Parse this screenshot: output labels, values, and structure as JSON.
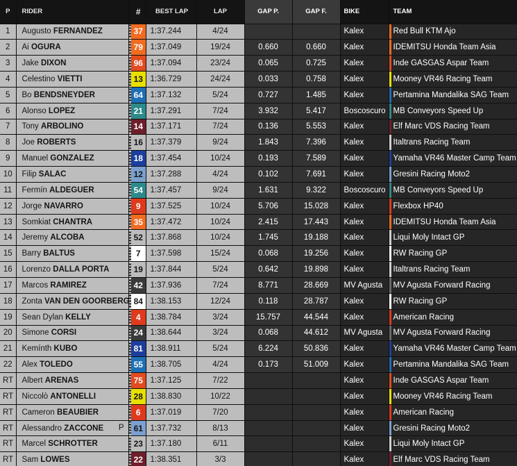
{
  "headers": {
    "p": "P",
    "rider": "RIDER",
    "num": "#",
    "best_lap": "BEST LAP",
    "lap": "LAP",
    "gap_p": "GAP P.",
    "gap_f": "GAP F.",
    "bike": "BIKE",
    "team": "TEAM"
  },
  "rows": [
    {
      "pos": "1",
      "first": "Augusto",
      "last": "FERNANDEZ",
      "pit": "",
      "num": "37",
      "num_bg": "#f26b21",
      "num_fg": "#ffffff",
      "best": "1:37.244",
      "lap": "4/24",
      "gap_p": "",
      "gap_f": "",
      "bike": "Kalex",
      "team": "Red Bull KTM Ajo",
      "team_color": "#f26b21"
    },
    {
      "pos": "2",
      "first": "Ai",
      "last": "OGURA",
      "pit": "",
      "num": "79",
      "num_bg": "#f26b21",
      "num_fg": "#ffffff",
      "best": "1:37.049",
      "lap": "19/24",
      "gap_p": "0.660",
      "gap_f": "0.660",
      "bike": "Kalex",
      "team": "IDEMITSU Honda Team Asia",
      "team_color": "#f26b21"
    },
    {
      "pos": "3",
      "first": "Jake",
      "last": "DIXON",
      "pit": "",
      "num": "96",
      "num_bg": "#e34b1f",
      "num_fg": "#ffffff",
      "best": "1:37.094",
      "lap": "23/24",
      "gap_p": "0.065",
      "gap_f": "0.725",
      "bike": "Kalex",
      "team": "Inde GASGAS Aspar Team",
      "team_color": "#e34b1f"
    },
    {
      "pos": "4",
      "first": "Celestino",
      "last": "VIETTI",
      "pit": "",
      "num": "13",
      "num_bg": "#e8e000",
      "num_fg": "#141414",
      "best": "1:36.729",
      "lap": "24/24",
      "gap_p": "0.033",
      "gap_f": "0.758",
      "bike": "Kalex",
      "team": "Mooney VR46 Racing Team",
      "team_color": "#e8e000"
    },
    {
      "pos": "5",
      "first": "Bo",
      "last": "BENDSNEYDER",
      "pit": "",
      "num": "64",
      "num_bg": "#1f6fb5",
      "num_fg": "#ffffff",
      "best": "1:37.132",
      "lap": "5/24",
      "gap_p": "0.727",
      "gap_f": "1.485",
      "bike": "Kalex",
      "team": "Pertamina Mandalika SAG Team",
      "team_color": "#1f6fb5"
    },
    {
      "pos": "6",
      "first": "Alonso",
      "last": "LOPEZ",
      "pit": "",
      "num": "21",
      "num_bg": "#2d8a8a",
      "num_fg": "#ffffff",
      "best": "1:37.291",
      "lap": "7/24",
      "gap_p": "3.932",
      "gap_f": "5.417",
      "bike": "Boscoscuro",
      "team": "MB Conveyors Speed Up",
      "team_color": "#2d8a8a"
    },
    {
      "pos": "7",
      "first": "Tony",
      "last": "ARBOLINO",
      "pit": "",
      "num": "14",
      "num_bg": "#6e1f2b",
      "num_fg": "#ffffff",
      "best": "1:37.171",
      "lap": "7/24",
      "gap_p": "0.136",
      "gap_f": "5.553",
      "bike": "Kalex",
      "team": "Elf Marc VDS Racing Team",
      "team_color": "#6e1f2b"
    },
    {
      "pos": "8",
      "first": "Joe",
      "last": "ROBERTS",
      "pit": "",
      "num": "16",
      "num_bg": "#bdbdbd",
      "num_fg": "#141414",
      "best": "1:37.379",
      "lap": "9/24",
      "gap_p": "1.843",
      "gap_f": "7.396",
      "bike": "Kalex",
      "team": "Italtrans Racing Team",
      "team_color": "#d0d0d0"
    },
    {
      "pos": "9",
      "first": "Manuel",
      "last": "GONZALEZ",
      "pit": "",
      "num": "18",
      "num_bg": "#1c3f9e",
      "num_fg": "#ffffff",
      "best": "1:37.454",
      "lap": "10/24",
      "gap_p": "0.193",
      "gap_f": "7.589",
      "bike": "Kalex",
      "team": "Yamaha VR46 Master Camp Team",
      "team_color": "#1c3f9e"
    },
    {
      "pos": "10",
      "first": "Filip",
      "last": "SALAC",
      "pit": "",
      "num": "12",
      "num_bg": "#7aa0d0",
      "num_fg": "#141414",
      "best": "1:37.288",
      "lap": "4/24",
      "gap_p": "0.102",
      "gap_f": "7.691",
      "bike": "Kalex",
      "team": "Gresini Racing Moto2",
      "team_color": "#7aa0d0"
    },
    {
      "pos": "11",
      "first": "Fermín",
      "last": "ALDEGUER",
      "pit": "",
      "num": "54",
      "num_bg": "#2d8a8a",
      "num_fg": "#ffffff",
      "best": "1:37.457",
      "lap": "9/24",
      "gap_p": "1.631",
      "gap_f": "9.322",
      "bike": "Boscoscuro",
      "team": "MB Conveyors Speed Up",
      "team_color": "#2d8a8a"
    },
    {
      "pos": "12",
      "first": "Jorge",
      "last": "NAVARRO",
      "pit": "",
      "num": "9",
      "num_bg": "#e03a1e",
      "num_fg": "#ffffff",
      "best": "1:37.525",
      "lap": "10/24",
      "gap_p": "5.706",
      "gap_f": "15.028",
      "bike": "Kalex",
      "team": "Flexbox HP40",
      "team_color": "#e03a1e"
    },
    {
      "pos": "13",
      "first": "Somkiat",
      "last": "CHANTRA",
      "pit": "",
      "num": "35",
      "num_bg": "#f26b21",
      "num_fg": "#ffffff",
      "best": "1:37.472",
      "lap": "10/24",
      "gap_p": "2.415",
      "gap_f": "17.443",
      "bike": "Kalex",
      "team": "IDEMITSU Honda Team Asia",
      "team_color": "#f26b21"
    },
    {
      "pos": "14",
      "first": "Jeremy",
      "last": "ALCOBA",
      "pit": "",
      "num": "52",
      "num_bg": "#bdbdbd",
      "num_fg": "#141414",
      "best": "1:37.868",
      "lap": "10/24",
      "gap_p": "1.745",
      "gap_f": "19.188",
      "bike": "Kalex",
      "team": "Liqui Moly Intact GP",
      "team_color": "#d0d0d0"
    },
    {
      "pos": "15",
      "first": "Barry",
      "last": "BALTUS",
      "pit": "",
      "num": "7",
      "num_bg": "#ffffff",
      "num_fg": "#141414",
      "best": "1:37.598",
      "lap": "15/24",
      "gap_p": "0.068",
      "gap_f": "19.256",
      "bike": "Kalex",
      "team": "RW Racing GP",
      "team_color": "#ffffff"
    },
    {
      "pos": "16",
      "first": "Lorenzo",
      "last": "DALLA PORTA",
      "pit": "",
      "num": "19",
      "num_bg": "#bdbdbd",
      "num_fg": "#141414",
      "best": "1:37.844",
      "lap": "5/24",
      "gap_p": "0.642",
      "gap_f": "19.898",
      "bike": "Kalex",
      "team": "Italtrans Racing Team",
      "team_color": "#d0d0d0"
    },
    {
      "pos": "17",
      "first": "Marcos",
      "last": "RAMIREZ",
      "pit": "",
      "num": "42",
      "num_bg": "#3a3a3a",
      "num_fg": "#ffffff",
      "best": "1:37.936",
      "lap": "7/24",
      "gap_p": "8.771",
      "gap_f": "28.669",
      "bike": "MV Agusta",
      "team": "MV Agusta Forward Racing",
      "team_color": "#6b6b6b"
    },
    {
      "pos": "18",
      "first": "Zonta",
      "last": "VAN DEN GOORBERGH",
      "pit": "",
      "num": "84",
      "num_bg": "#ffffff",
      "num_fg": "#141414",
      "best": "1:38.153",
      "lap": "12/24",
      "gap_p": "0.118",
      "gap_f": "28.787",
      "bike": "Kalex",
      "team": "RW Racing GP",
      "team_color": "#ffffff"
    },
    {
      "pos": "19",
      "first": "Sean Dylan",
      "last": "KELLY",
      "pit": "",
      "num": "4",
      "num_bg": "#e03a1e",
      "num_fg": "#ffffff",
      "best": "1:38.784",
      "lap": "3/24",
      "gap_p": "15.757",
      "gap_f": "44.544",
      "bike": "Kalex",
      "team": "American Racing",
      "team_color": "#e03a1e"
    },
    {
      "pos": "20",
      "first": "Simone",
      "last": "CORSI",
      "pit": "",
      "num": "24",
      "num_bg": "#3a3a3a",
      "num_fg": "#ffffff",
      "best": "1:38.644",
      "lap": "3/24",
      "gap_p": "0.068",
      "gap_f": "44.612",
      "bike": "MV Agusta",
      "team": "MV Agusta Forward Racing",
      "team_color": "#6b6b6b"
    },
    {
      "pos": "21",
      "first": "Kemínth",
      "last": "KUBO",
      "pit": "",
      "num": "81",
      "num_bg": "#1c3f9e",
      "num_fg": "#ffffff",
      "best": "1:38.911",
      "lap": "5/24",
      "gap_p": "6.224",
      "gap_f": "50.836",
      "bike": "Kalex",
      "team": "Yamaha VR46 Master Camp Team",
      "team_color": "#1c3f9e"
    },
    {
      "pos": "22",
      "first": "Alex",
      "last": "TOLEDO",
      "pit": "",
      "num": "55",
      "num_bg": "#1f6fb5",
      "num_fg": "#ffffff",
      "best": "1:38.705",
      "lap": "4/24",
      "gap_p": "0.173",
      "gap_f": "51.009",
      "bike": "Kalex",
      "team": "Pertamina Mandalika SAG Team",
      "team_color": "#1f6fb5"
    },
    {
      "pos": "RT",
      "first": "Albert",
      "last": "ARENAS",
      "pit": "",
      "num": "75",
      "num_bg": "#e34b1f",
      "num_fg": "#ffffff",
      "best": "1:37.125",
      "lap": "7/22",
      "gap_p": "",
      "gap_f": "",
      "bike": "Kalex",
      "team": "Inde GASGAS Aspar Team",
      "team_color": "#e34b1f"
    },
    {
      "pos": "RT",
      "first": "Niccolò",
      "last": "ANTONELLI",
      "pit": "",
      "num": "28",
      "num_bg": "#e8e000",
      "num_fg": "#141414",
      "best": "1:38.830",
      "lap": "10/22",
      "gap_p": "",
      "gap_f": "",
      "bike": "Kalex",
      "team": "Mooney VR46 Racing Team",
      "team_color": "#e8e000"
    },
    {
      "pos": "RT",
      "first": "Cameron",
      "last": "BEAUBIER",
      "pit": "",
      "num": "6",
      "num_bg": "#e03a1e",
      "num_fg": "#ffffff",
      "best": "1:37.019",
      "lap": "7/20",
      "gap_p": "",
      "gap_f": "",
      "bike": "Kalex",
      "team": "American Racing",
      "team_color": "#e03a1e"
    },
    {
      "pos": "RT",
      "first": "Alessandro",
      "last": "ZACCONE",
      "pit": "P",
      "num": "61",
      "num_bg": "#7aa0d0",
      "num_fg": "#141414",
      "best": "1:37.732",
      "lap": "8/13",
      "gap_p": "",
      "gap_f": "",
      "bike": "Kalex",
      "team": "Gresini Racing Moto2",
      "team_color": "#7aa0d0"
    },
    {
      "pos": "RT",
      "first": "Marcel",
      "last": "SCHROTTER",
      "pit": "",
      "num": "23",
      "num_bg": "#bdbdbd",
      "num_fg": "#141414",
      "best": "1:37.180",
      "lap": "6/11",
      "gap_p": "",
      "gap_f": "",
      "bike": "Kalex",
      "team": "Liqui Moly Intact GP",
      "team_color": "#d0d0d0"
    },
    {
      "pos": "RT",
      "first": "Sam",
      "last": "LOWES",
      "pit": "",
      "num": "22",
      "num_bg": "#6e1f2b",
      "num_fg": "#ffffff",
      "best": "1:38.351",
      "lap": "3/3",
      "gap_p": "",
      "gap_f": "",
      "bike": "Kalex",
      "team": "Elf Marc VDS Racing Team",
      "team_color": "#6e1f2b"
    }
  ]
}
